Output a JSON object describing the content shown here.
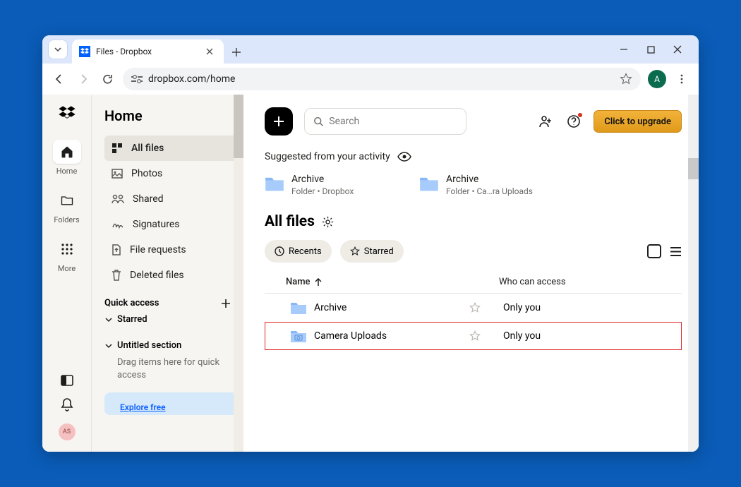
{
  "browser": {
    "tab_title": "Files - Dropbox",
    "url": "dropbox.com/home",
    "avatar_letter": "A"
  },
  "rail": {
    "items": [
      {
        "label": "Home",
        "icon": "home",
        "active": true
      },
      {
        "label": "Folders",
        "icon": "folders",
        "active": false
      },
      {
        "label": "More",
        "icon": "more",
        "active": false
      }
    ],
    "avatar_initials": "AS"
  },
  "sidebar": {
    "title": "Home",
    "items": [
      {
        "label": "All files",
        "icon": "allfiles",
        "active": true
      },
      {
        "label": "Photos",
        "icon": "photos"
      },
      {
        "label": "Shared",
        "icon": "shared"
      },
      {
        "label": "Signatures",
        "icon": "signatures"
      },
      {
        "label": "File requests",
        "icon": "requests"
      },
      {
        "label": "Deleted files",
        "icon": "deleted"
      }
    ],
    "quick_access_title": "Quick access",
    "starred_label": "Starred",
    "untitled_label": "Untitled section",
    "drag_hint": "Drag items here for quick access",
    "explore_label": "Explore free"
  },
  "main": {
    "search_placeholder": "Search",
    "upgrade_label": "Click to upgrade",
    "suggested_label": "Suggested from your activity",
    "suggestions": [
      {
        "name": "Archive",
        "meta": "Folder • Dropbox"
      },
      {
        "name": "Archive",
        "meta": "Folder • Ca…ra Uploads"
      }
    ],
    "allfiles_title": "All files",
    "filters": {
      "recents": "Recents",
      "starred": "Starred"
    },
    "table": {
      "col_name": "Name",
      "col_access": "Who can access",
      "rows": [
        {
          "name": "Archive",
          "access": "Only you",
          "highlight": false,
          "icon": "folder"
        },
        {
          "name": "Camera Uploads",
          "access": "Only you",
          "highlight": true,
          "icon": "folder-camera"
        }
      ]
    }
  }
}
